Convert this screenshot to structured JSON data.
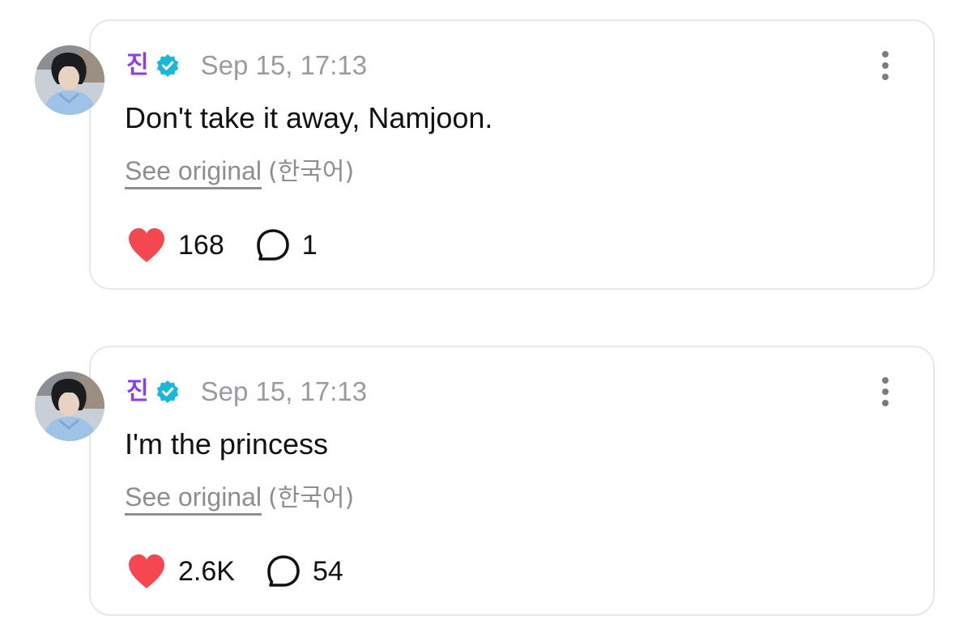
{
  "colors": {
    "author": "#8a3df0",
    "verified": "#19b8d8",
    "heart": "#f4474f",
    "muted": "#9a9aa0",
    "card_border": "#e6e6ee"
  },
  "posts": [
    {
      "author": "진",
      "verified_icon": "verified-badge-icon",
      "timestamp": "Sep 15, 17:13",
      "message": "Don't take it away, Namjoon.",
      "see_original": "See original",
      "language": "(한국어)",
      "likes": "168",
      "comments": "1"
    },
    {
      "author": "진",
      "verified_icon": "verified-badge-icon",
      "timestamp": "Sep 15, 17:13",
      "message": "I'm the princess",
      "see_original": "See original",
      "language": "(한국어)",
      "likes": "2.6K",
      "comments": "54"
    }
  ]
}
